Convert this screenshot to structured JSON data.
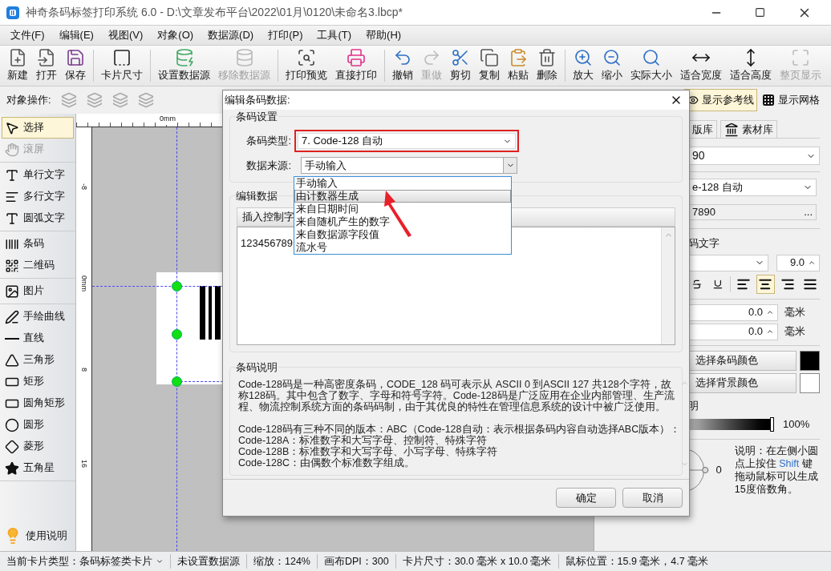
{
  "window": {
    "title": "神奇条码标签打印系统 6.0 - D:\\文章发布平台\\2022\\01月\\0120\\未命名3.lbcp*"
  },
  "menu": [
    "文件(F)",
    "编辑(E)",
    "视图(V)",
    "对象(O)",
    "数据源(D)",
    "打印(P)",
    "工具(T)",
    "帮助(H)"
  ],
  "toolbar_groups": [
    [
      {
        "label": "新建",
        "disabled": false
      },
      {
        "label": "打开",
        "disabled": false
      },
      {
        "label": "保存",
        "disabled": false
      }
    ],
    [
      {
        "label": "卡片尺寸",
        "disabled": false
      }
    ],
    [
      {
        "label": "设置数据源",
        "disabled": false
      },
      {
        "label": "移除数据源",
        "disabled": true
      }
    ],
    [
      {
        "label": "打印预览",
        "disabled": false
      },
      {
        "label": "直接打印",
        "disabled": false
      }
    ],
    [
      {
        "label": "撤销",
        "disabled": false
      },
      {
        "label": "重做",
        "disabled": true
      },
      {
        "label": "剪切",
        "disabled": false
      },
      {
        "label": "复制",
        "disabled": false
      },
      {
        "label": "粘贴",
        "disabled": false
      },
      {
        "label": "删除",
        "disabled": false
      }
    ],
    [
      {
        "label": "放大",
        "disabled": false
      },
      {
        "label": "缩小",
        "disabled": false
      },
      {
        "label": "实际大小",
        "disabled": false
      },
      {
        "label": "适合宽度",
        "disabled": false
      },
      {
        "label": "适合高度",
        "disabled": false
      },
      {
        "label": "整页显示",
        "disabled": true
      }
    ]
  ],
  "object_bar": {
    "label": "对象操作:",
    "toggles": [
      {
        "label": "显示参考线",
        "selected": true
      },
      {
        "label": "显示网格",
        "selected": false
      }
    ]
  },
  "tool_groups": [
    [
      {
        "label": "选择",
        "selected": true,
        "disabled": false
      },
      {
        "label": "滚屏",
        "selected": false,
        "disabled": true
      }
    ],
    [
      {
        "label": "单行文字",
        "selected": false,
        "disabled": false
      },
      {
        "label": "多行文字",
        "selected": false,
        "disabled": false
      },
      {
        "label": "圆弧文字",
        "selected": false,
        "disabled": false
      }
    ],
    [
      {
        "label": "条码",
        "selected": false,
        "disabled": false
      },
      {
        "label": "二维码",
        "selected": false,
        "disabled": false
      }
    ],
    [
      {
        "label": "图片",
        "selected": false,
        "disabled": false
      }
    ],
    [
      {
        "label": "手绘曲线",
        "selected": false,
        "disabled": false
      },
      {
        "label": "直线",
        "selected": false,
        "disabled": false
      },
      {
        "label": "三角形",
        "selected": false,
        "disabled": false
      },
      {
        "label": "矩形",
        "selected": false,
        "disabled": false
      },
      {
        "label": "圆角矩形",
        "selected": false,
        "disabled": false
      },
      {
        "label": "圆形",
        "selected": false,
        "disabled": false
      },
      {
        "label": "菱形",
        "selected": false,
        "disabled": false
      },
      {
        "label": "五角星",
        "selected": false,
        "disabled": false
      }
    ]
  ],
  "help_tool": {
    "label": "使用说明"
  },
  "canvas": {
    "h_ruler": [
      "0mm"
    ],
    "v_ruler": [
      "-8",
      "0mm",
      "8",
      "16"
    ]
  },
  "dialog": {
    "title": "编辑条码数据:",
    "barcode_settings": {
      "title": "条码设置",
      "type_label": "条码类型:",
      "type_value": "7. Code-128 自动",
      "source_label": "数据来源:",
      "source_value": "手动输入",
      "source_options": [
        {
          "label": "手动输入",
          "selected": false
        },
        {
          "label": "由计数器生成",
          "selected": true
        },
        {
          "label": "来自日期时间",
          "selected": false
        },
        {
          "label": "来自随机产生的数字",
          "selected": false
        },
        {
          "label": "来自数据源字段值",
          "selected": false
        },
        {
          "label": "流水号",
          "selected": false
        }
      ]
    },
    "edit_data": {
      "title": "编辑数据",
      "insert_button": "插入控制字",
      "value": "123456789"
    },
    "description": {
      "title": "条码说明",
      "paragraph": "Code-128码是一种高密度条码，CODE_128 码可表示从 ASCII 0 到ASCII 127 共128个字符，故称128码。其中包含了数字、字母和符号字符。Code-128码是广泛应用在企业内部管理、生产流程、物流控制系统方面的条码码制，由于其优良的特性在管理信息系统的设计中被广泛使用。",
      "lines": [
        "Code-128码有三种不同的版本：ABC（Code-128自动：表示根据条码内容自动选择ABC版本）：",
        "Code-128A：标准数字和大写字母、控制符、特殊字符",
        "Code-128B：标准数字和大写字母、小写字母、特殊字符",
        "Code-128C：由偶数个标准数字组成。"
      ]
    },
    "buttons": [
      "确定",
      "取消"
    ]
  },
  "right_panel": {
    "tabs": [
      "版库",
      "素材库"
    ],
    "value_select": "90",
    "type_select": "e-128 自动",
    "data_field": "7890",
    "data_field_button": "...",
    "text_section": "码文字",
    "font_size": "9.0",
    "align": [
      {
        "selected": false
      },
      {
        "selected": true
      },
      {
        "selected": false
      },
      {
        "selected": false
      }
    ],
    "offsets": [
      {
        "value": "0.0",
        "unit": "毫米"
      },
      {
        "value": "0.0",
        "unit": "毫米"
      }
    ],
    "colors": [
      {
        "label": "选择条码颜色",
        "color": "#000000"
      },
      {
        "label": "选择背景颜色",
        "color": "#ffffff"
      }
    ],
    "opacity_label": "明",
    "opacity": {
      "level": 1,
      "reading": "100%"
    },
    "rotation": "0",
    "note": [
      "说明：在左侧小圆点上按住 ",
      "Shift",
      " 键拖动鼠标可以生成15度倍数角。"
    ]
  },
  "status_bar": [
    "当前卡片类型：条码标签类卡片",
    "未设置数据源",
    "缩放：124%",
    "画布DPI：300",
    "卡片尺寸：30.0 毫米 x 10.0 毫米",
    "鼠标位置：15.9 毫米，4.7 毫米"
  ]
}
